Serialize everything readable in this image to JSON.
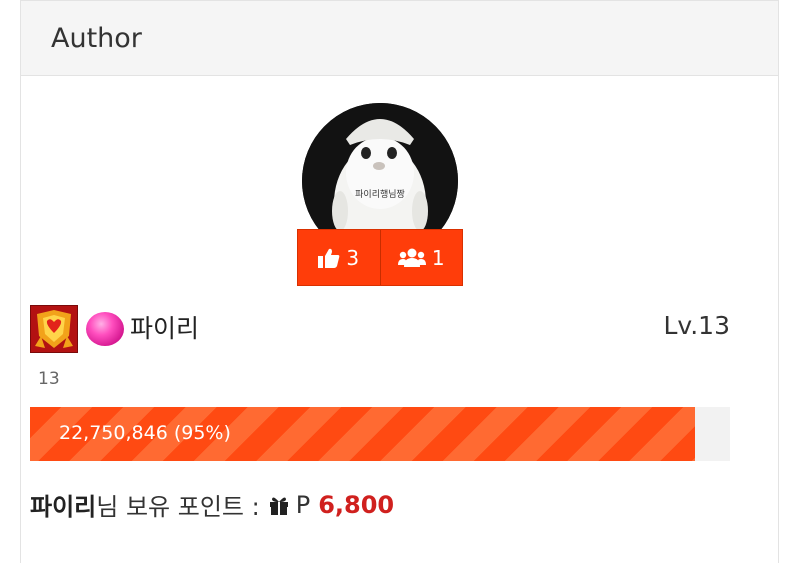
{
  "header": {
    "title": "Author"
  },
  "profile": {
    "avatar_caption": "파이리행님짱",
    "likes": "3",
    "friends": "1",
    "username": "파이리",
    "level_label": "Lv.13",
    "level_number": "13",
    "exp_text": "22,750,846 (95%)",
    "exp_percent": 95
  },
  "points": {
    "name": "파이리",
    "suffix": "님 보유 포인트 :",
    "unit": "P",
    "value": "6,800"
  },
  "colors": {
    "accent": "#ff3d0a",
    "points_value": "#d0201e",
    "badge_bg": "#b21010"
  },
  "icons": [
    "thumbs-up-icon",
    "users-icon",
    "gift-icon",
    "level-badge-icon",
    "orb-icon"
  ]
}
